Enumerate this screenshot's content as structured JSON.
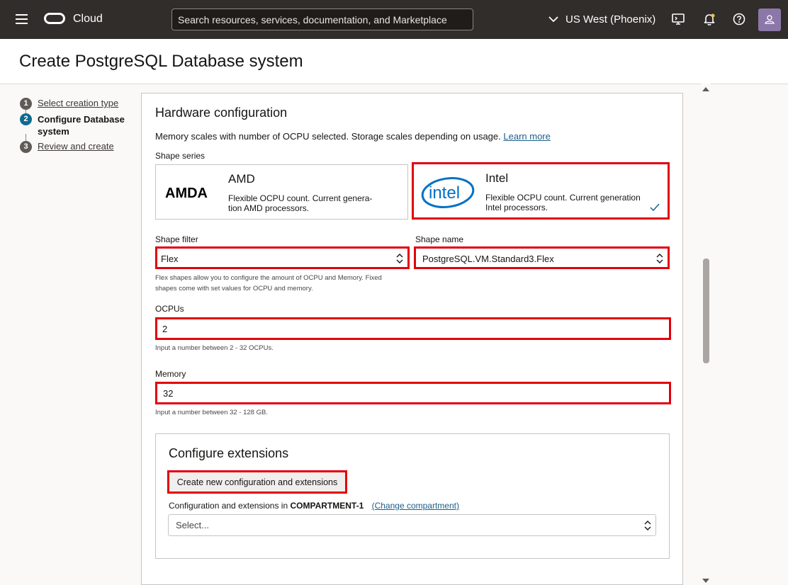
{
  "topbar": {
    "app_name": "Cloud",
    "search_placeholder": "Search resources, services, documentation, and Marketplace",
    "region": "US West (Phoenix)"
  },
  "page": {
    "title": "Create PostgreSQL Database system"
  },
  "steps": [
    {
      "num": "1",
      "label": "Select creation type"
    },
    {
      "num": "2",
      "label": "Configure Database system"
    },
    {
      "num": "3",
      "label": "Review and create"
    }
  ],
  "hardware": {
    "title": "Hardware configuration",
    "desc": "Memory scales with number of OCPU selected. Storage scales depending on usage.",
    "learn_more": "Learn more",
    "shape_series_label": "Shape series",
    "amd": {
      "logo": "AMDA",
      "title": "AMD",
      "desc_line1": "Flexible OCPU count. Current genera-",
      "desc_line2": "tion AMD processors."
    },
    "intel": {
      "logo": "intel",
      "title": "Intel",
      "desc_line1": "Flexible OCPU count. Current generation",
      "desc_line2": "Intel processors.",
      "selected": true
    },
    "shape_filter_label": "Shape filter",
    "shape_filter_value": "Flex",
    "shape_name_label": "Shape name",
    "shape_name_value": "PostgreSQL.VM.Standard3.Flex",
    "flex_help_line1": "Flex shapes allow you to configure the amount of OCPU and Memory. Fixed",
    "flex_help_line2": "shapes come with set values for OCPU and memory.",
    "ocpus_label": "OCPUs",
    "ocpus_value": "2",
    "ocpus_help": "Input a number between 2 - 32 OCPUs.",
    "memory_label": "Memory",
    "memory_value": "32",
    "memory_help": "Input a number between 32 - 128 GB."
  },
  "extensions": {
    "title": "Configure extensions",
    "create_button": "Create new configuration and extensions",
    "compartment_prefix": "Configuration and extensions in",
    "compartment_name": "COMPARTMENT-1",
    "change_compartment": "(Change compartment)",
    "select_placeholder": "Select..."
  },
  "colors": {
    "highlight": "#e2000f",
    "topbar": "#312d2a",
    "link": "#1c5d89",
    "active_step": "#0f6b8e"
  }
}
